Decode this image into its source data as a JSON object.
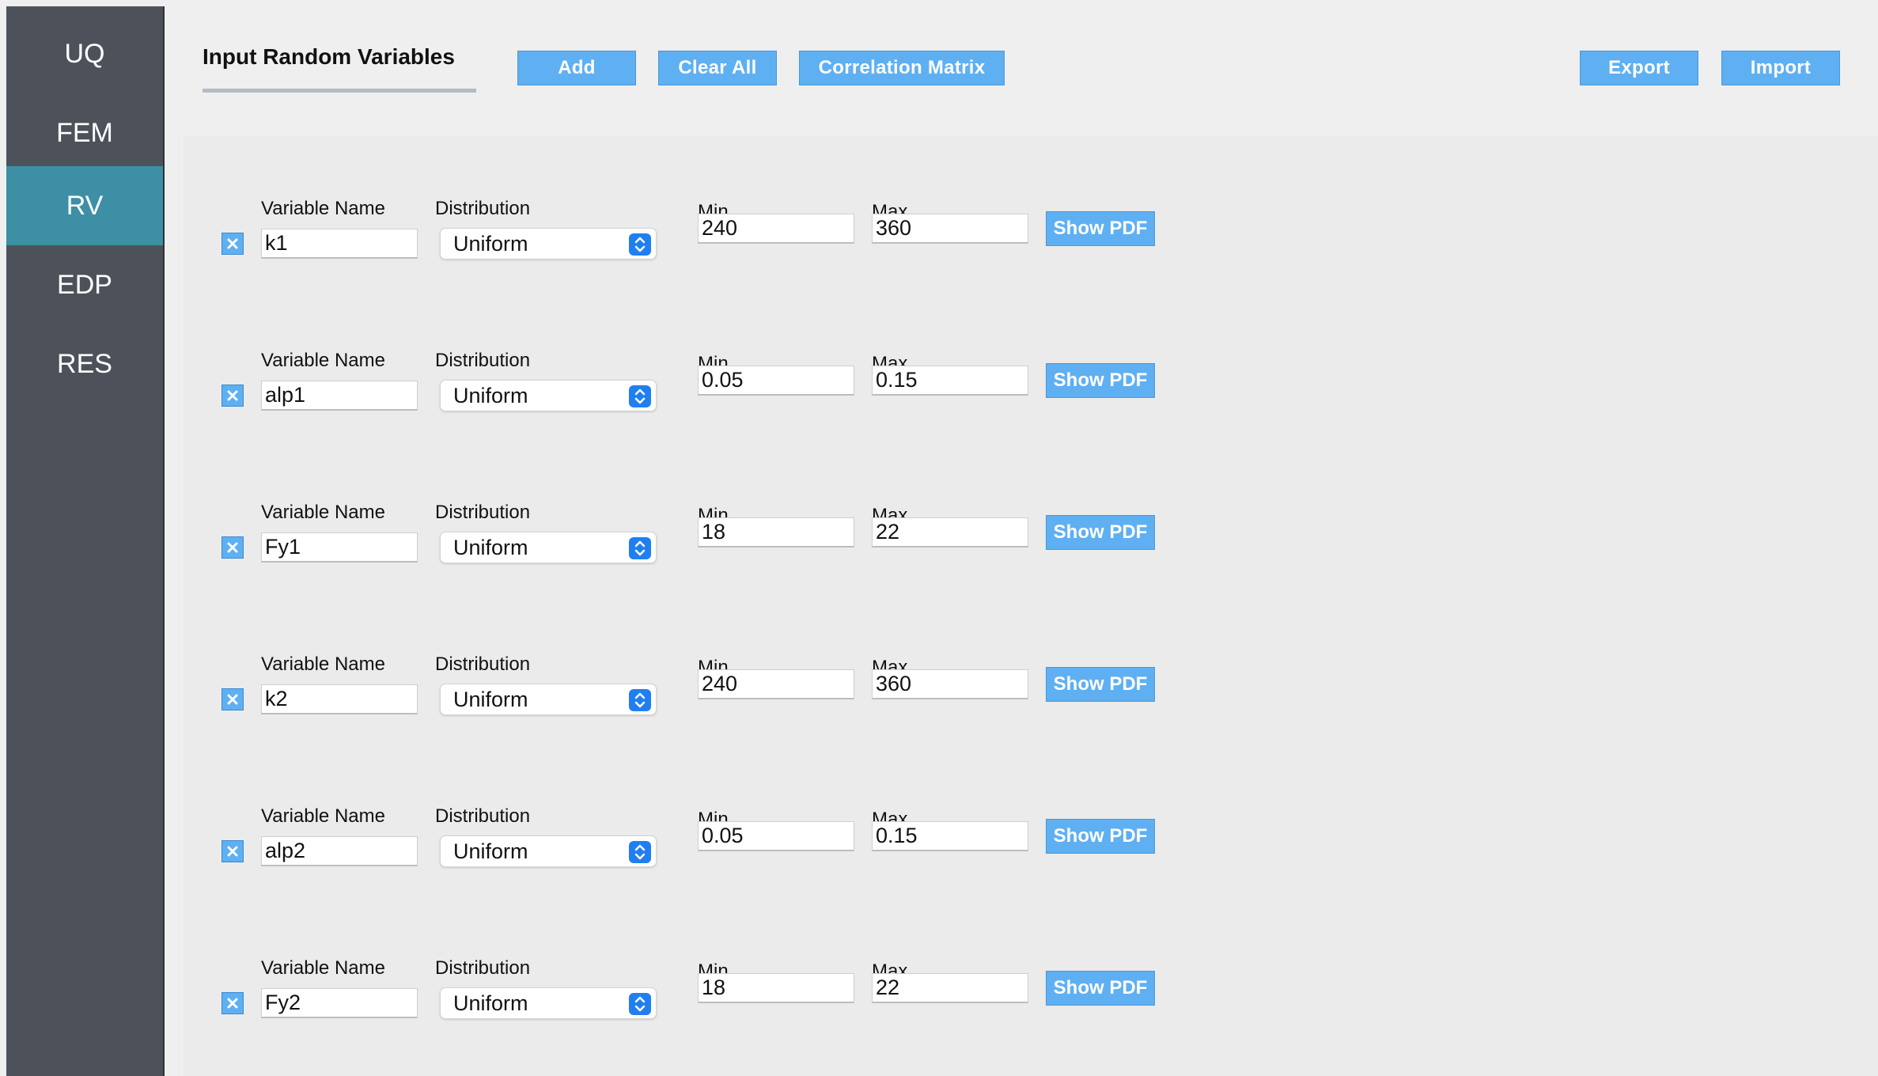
{
  "sidebar": {
    "items": [
      {
        "label": "UQ",
        "active": false
      },
      {
        "label": "FEM",
        "active": false
      },
      {
        "label": "RV",
        "active": true
      },
      {
        "label": "EDP",
        "active": false
      },
      {
        "label": "RES",
        "active": false
      }
    ]
  },
  "header": {
    "title": "Input Random Variables",
    "add_label": "Add",
    "clear_label": "Clear All",
    "correlation_label": "Correlation Matrix",
    "export_label": "Export",
    "import_label": "Import"
  },
  "labels": {
    "variable_name": "Variable Name",
    "distribution": "Distribution",
    "min": "Min.",
    "max": "Max.",
    "show_pdf": "Show PDF"
  },
  "variables": [
    {
      "name": "k1",
      "distribution": "Uniform",
      "min": "240",
      "max": "360"
    },
    {
      "name": "alp1",
      "distribution": "Uniform",
      "min": "0.05",
      "max": "0.15"
    },
    {
      "name": "Fy1",
      "distribution": "Uniform",
      "min": "18",
      "max": "22"
    },
    {
      "name": "k2",
      "distribution": "Uniform",
      "min": "240",
      "max": "360"
    },
    {
      "name": "alp2",
      "distribution": "Uniform",
      "min": "0.05",
      "max": "0.15"
    },
    {
      "name": "Fy2",
      "distribution": "Uniform",
      "min": "18",
      "max": "22"
    }
  ],
  "colors": {
    "sidebar_bg": "#4d525a",
    "sidebar_active": "#3d8fa6",
    "button_blue": "#5eb0f3",
    "select_arrow_blue": "#1f7ff2"
  }
}
